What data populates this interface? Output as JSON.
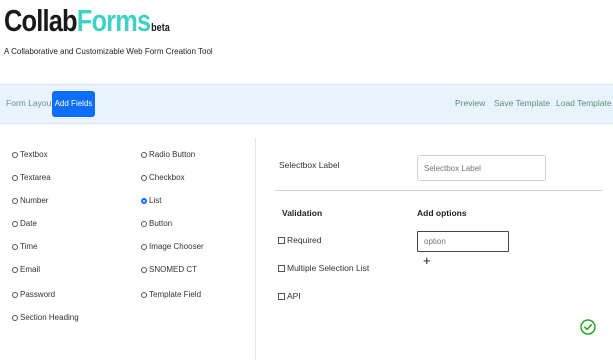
{
  "brand": {
    "logo_part1": "Collab",
    "logo_part2": "Forms",
    "beta": "beta",
    "tagline": "A Collaborative and Customizable Web Form Creation Tool"
  },
  "toolbar": {
    "form_layout": "Form Layout",
    "add_fields": "Add Fields",
    "preview": "Preview",
    "save_template": "Save Template",
    "load_template": "Load Template"
  },
  "palette": {
    "col1": [
      "Textbox",
      "Textarea",
      "Number",
      "Date",
      "Time",
      "Email",
      "Password",
      "Section Heading"
    ],
    "col2": [
      "Radio Button",
      "Checkbox",
      "List",
      "Button",
      "Image Chooser",
      "SNOMED CT",
      "Template Field"
    ],
    "selected": "List"
  },
  "settings": {
    "selectbox_label": "Selectbox Label",
    "selectbox_placeholder": "Selectbox Label",
    "validation": "Validation",
    "add_options": "Add options",
    "required": "Required",
    "multiple": "Multiple Selection List",
    "api": "API",
    "option_placeholder": "option",
    "add_option_symbol": "+"
  },
  "colors": {
    "accent": "#0d6efd",
    "brand_teal": "#3fd1c3",
    "toolbar_bg": "#e8f3fd",
    "toolbar_text": "#5a8f7c",
    "confirm": "#2aa52a"
  },
  "icons": {
    "add": "plus-icon",
    "confirm": "check-circle-icon"
  }
}
